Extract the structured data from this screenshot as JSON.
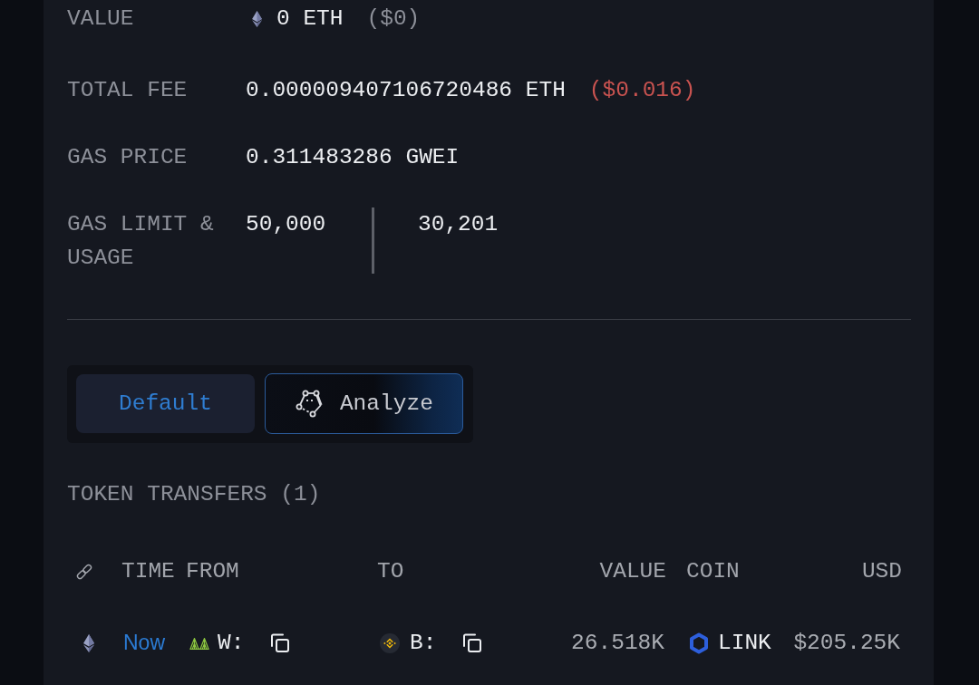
{
  "details": [
    {
      "kind": "amount",
      "label": "VALUE",
      "value": "0 ETH",
      "note": "($0)"
    },
    {
      "kind": "fee",
      "label": "TOTAL FEE",
      "value": "0.000009407106720486 ETH",
      "note": "($0.016)"
    },
    {
      "kind": "plain",
      "label": "GAS PRICE",
      "value": "0.311483286 GWEI"
    },
    {
      "kind": "split",
      "label": "GAS LIMIT & USAGE",
      "values": [
        "50,000",
        "30,201"
      ]
    }
  ],
  "view_toggle": {
    "options": [
      {
        "kind": "plain",
        "label": "Default",
        "selected": true
      },
      {
        "kind": "ai",
        "label": "Analyze",
        "selected": false
      }
    ]
  },
  "token_transfers": {
    "title": "TOKEN TRANSFERS (1)",
    "columns": [
      "TIME",
      "FROM",
      "TO",
      "VALUE",
      "COIN",
      "USD"
    ],
    "rows": [
      {
        "time": "Now",
        "from": "W:",
        "to": "B:",
        "value": "26.518K",
        "coin": "LINK",
        "usd": "$205.25K"
      }
    ]
  }
}
